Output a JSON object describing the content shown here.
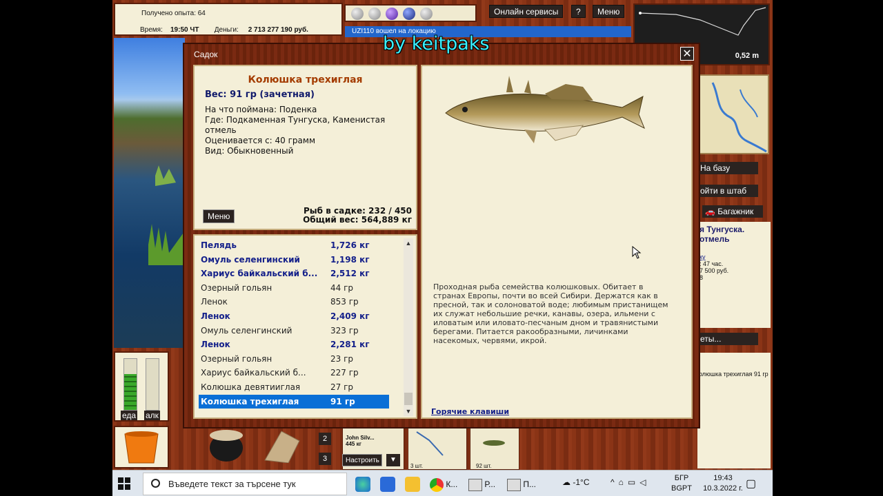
{
  "top": {
    "experience": "Получено опыта: 64",
    "time_label": "Время:",
    "time_value": "19:50 ЧТ",
    "money_label": "Деньги:",
    "money_value": "2 713 277 190 руб.",
    "online_services": "Онлайн сервисы",
    "help": "?",
    "menu": "Меню",
    "depth": "0,52 m",
    "news": "UZI110 вошел на локацию"
  },
  "side": {
    "to_base": "На базу",
    "to_hq": "ойти в штаб",
    "trunk": "Багажник",
    "location_line1": "я Тунгуска.",
    "location_line2": "отмель",
    "info_link": "ку",
    "info_hours": ": 47 час.",
    "info_price": "7 500 руб.",
    "info_num": "8",
    "more_button": "еты...",
    "log_entry": "олюшка трехиглая 91 гр"
  },
  "bottom": {
    "food_label": "еда",
    "alcohol_label": "алк",
    "food_level": 0.7,
    "alcohol_level": 0.0,
    "slot2": "2",
    "slot3": "3",
    "player_name": "John Silv...",
    "player_weight": "445 кг",
    "setup_button": "Настроить",
    "dropdown": "▼",
    "count1": "3 шт.",
    "count2": "92 шт."
  },
  "dialog": {
    "title": "Садок",
    "watermark": "by keitpaks",
    "fish_name": "Колюшка трехиглая",
    "weight": "Вес: 91 гр (зачетная)",
    "caught_on": "На что поймана: Поденка",
    "where": "Где: Подкаменная Тунгуска, Каменистая отмель",
    "valued_from": "Оценивается с: 40 грамм",
    "kind": "Вид: Обыкновенный",
    "menu_button": "Меню",
    "fish_in_keepnet": "Рыб в садке: 232 / 450",
    "total_weight": "Общий вес: 564,889 кг",
    "description": "Проходная рыба семейства колюшковых. Обитает в странах Европы, почти во всей Сибири. Держатся как в пресной, так и солоноватой воде; любимым пристанищем их служат небольшие речки, канавы, озера, ильмени с иловатым или иловато-песчаным дном и травянистыми берегами. Питается ракообразными, личинками насекомых, червями, икрой.",
    "hotkeys": "Горячие клавиши",
    "fish_list": [
      {
        "name": "Пелядь",
        "weight": "1,726 кг",
        "best": true
      },
      {
        "name": "Омуль селенгинский",
        "weight": "1,198 кг",
        "best": true
      },
      {
        "name": "Хариус байкальский б...",
        "weight": "2,512 кг",
        "best": true
      },
      {
        "name": "Озерный гольян",
        "weight": "44 гр",
        "best": false
      },
      {
        "name": "Ленок",
        "weight": "853 гр",
        "best": false
      },
      {
        "name": "Ленок",
        "weight": "2,409 кг",
        "best": true
      },
      {
        "name": "Омуль селенгинский",
        "weight": "323 гр",
        "best": false
      },
      {
        "name": "Ленок",
        "weight": "2,281 кг",
        "best": true
      },
      {
        "name": "Озерный гольян",
        "weight": "23 гр",
        "best": false
      },
      {
        "name": "Хариус байкальский б...",
        "weight": "227 гр",
        "best": false
      },
      {
        "name": "Колюшка девятииглая",
        "weight": "27 гр",
        "best": false
      },
      {
        "name": "Колюшка трехиглая",
        "weight": "91 гр",
        "best": true,
        "selected": true
      }
    ]
  },
  "taskbar": {
    "search_placeholder": "Въведете текст за търсене тук",
    "app_chrome": "К...",
    "app_r": "Р...",
    "app_p": "П...",
    "weather": "-1°C",
    "lang_top": "БГР",
    "lang_bottom": "BGPT",
    "time": "19:43",
    "date": "10.3.2022 г."
  }
}
